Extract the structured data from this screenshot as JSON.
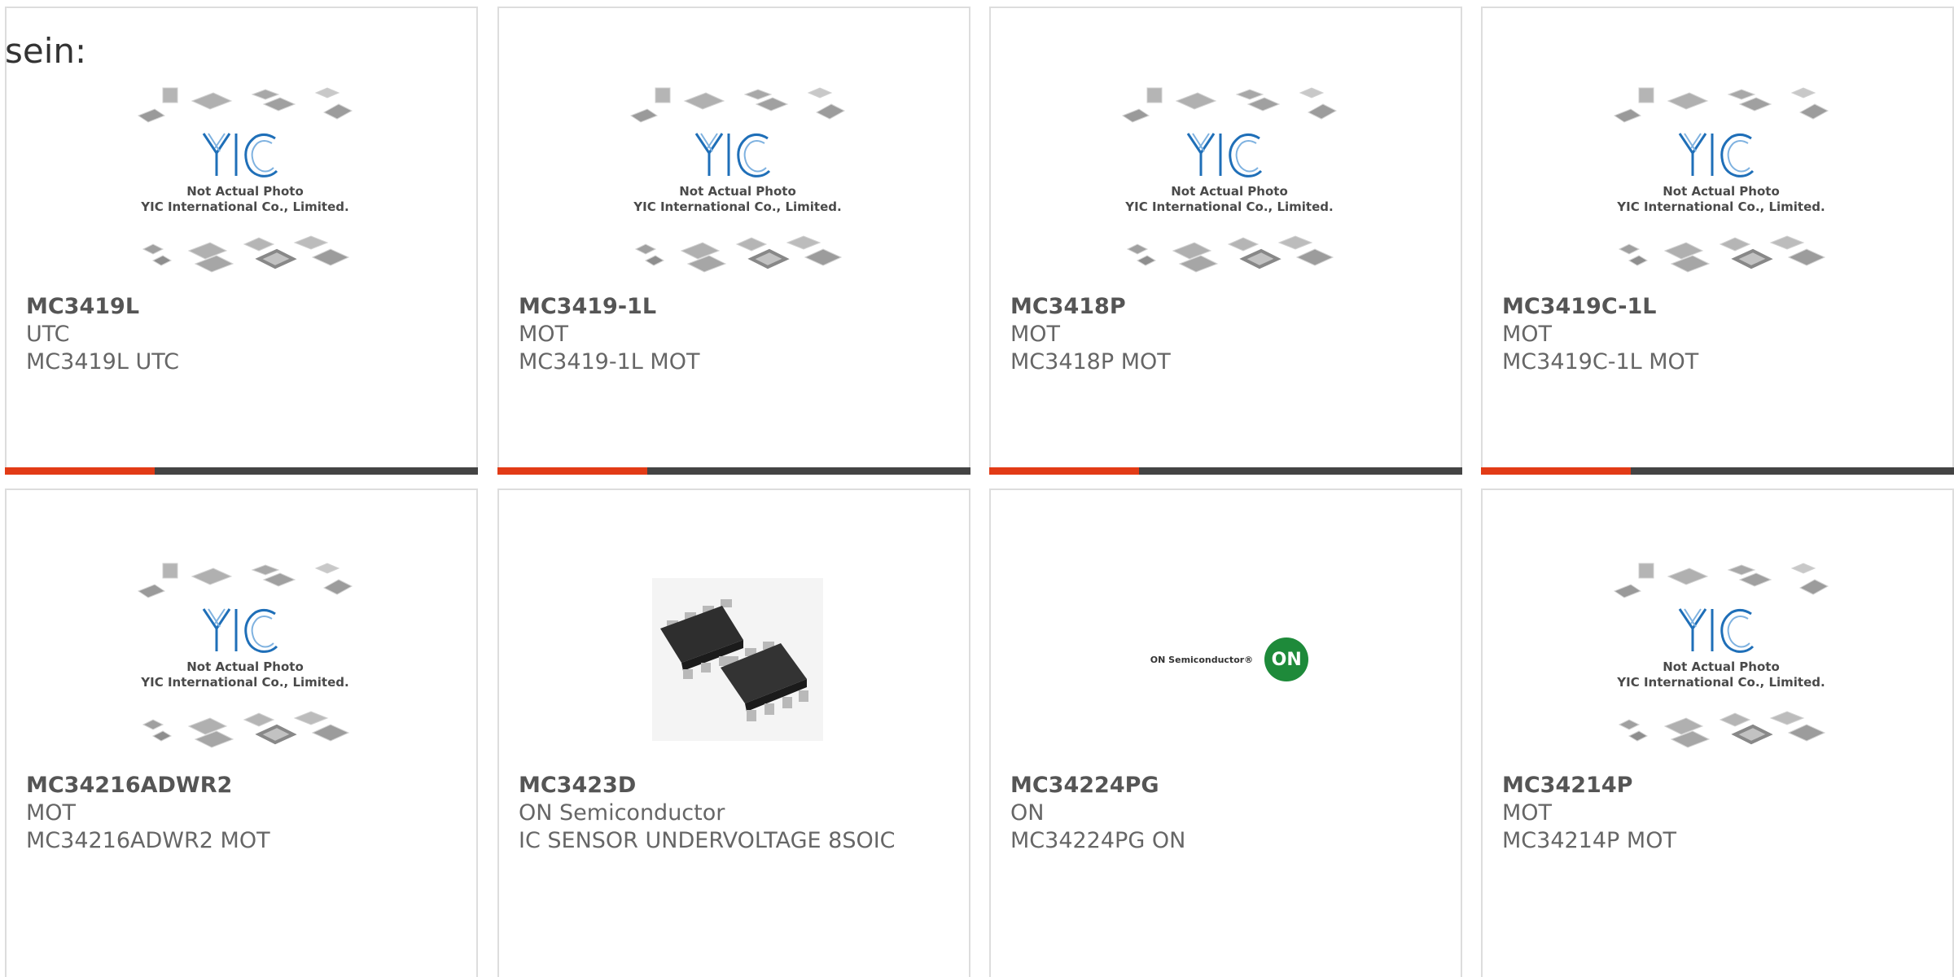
{
  "intro_text": "sein:",
  "placeholder_image": {
    "line1": "Not Actual Photo",
    "line2": "YIC International Co., Limited."
  },
  "on_logo_text": "ON Semiconductor®",
  "on_logo_badge": "ON",
  "colors": {
    "accent": "#e23b16",
    "bar": "#444444",
    "logo_blue": "#1f6fb8",
    "on_green": "#1e8a3a"
  },
  "products": [
    {
      "part": "MC3419L",
      "maker": "UTC",
      "desc": "MC3419L UTC",
      "image": "yic-placeholder"
    },
    {
      "part": "MC3419-1L",
      "maker": "MOT",
      "desc": "MC3419-1L MOT",
      "image": "yic-placeholder"
    },
    {
      "part": "MC3418P",
      "maker": "MOT",
      "desc": "MC3418P MOT",
      "image": "yic-placeholder"
    },
    {
      "part": "MC3419C-1L",
      "maker": "MOT",
      "desc": "MC3419C-1L MOT",
      "image": "yic-placeholder"
    },
    {
      "part": "MC34216ADWR2",
      "maker": "MOT",
      "desc": "MC34216ADWR2 MOT",
      "image": "yic-placeholder"
    },
    {
      "part": "MC3423D",
      "maker": "ON Semiconductor",
      "desc": "IC SENSOR UNDERVOLTAGE 8SOIC",
      "image": "soic-chip-photo"
    },
    {
      "part": "MC34224PG",
      "maker": "ON",
      "desc": "MC34224PG ON",
      "image": "on-semiconductor-logo"
    },
    {
      "part": "MC34214P",
      "maker": "MOT",
      "desc": "MC34214P MOT",
      "image": "yic-placeholder"
    }
  ]
}
